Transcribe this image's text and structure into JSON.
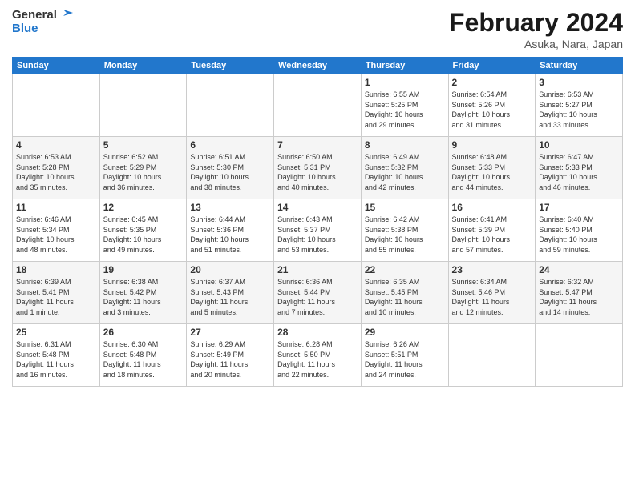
{
  "header": {
    "logo_general": "General",
    "logo_blue": "Blue",
    "month_title": "February 2024",
    "location": "Asuka, Nara, Japan"
  },
  "days_of_week": [
    "Sunday",
    "Monday",
    "Tuesday",
    "Wednesday",
    "Thursday",
    "Friday",
    "Saturday"
  ],
  "weeks": [
    [
      {
        "day": "",
        "detail": ""
      },
      {
        "day": "",
        "detail": ""
      },
      {
        "day": "",
        "detail": ""
      },
      {
        "day": "",
        "detail": ""
      },
      {
        "day": "1",
        "detail": "Sunrise: 6:55 AM\nSunset: 5:25 PM\nDaylight: 10 hours\nand 29 minutes."
      },
      {
        "day": "2",
        "detail": "Sunrise: 6:54 AM\nSunset: 5:26 PM\nDaylight: 10 hours\nand 31 minutes."
      },
      {
        "day": "3",
        "detail": "Sunrise: 6:53 AM\nSunset: 5:27 PM\nDaylight: 10 hours\nand 33 minutes."
      }
    ],
    [
      {
        "day": "4",
        "detail": "Sunrise: 6:53 AM\nSunset: 5:28 PM\nDaylight: 10 hours\nand 35 minutes."
      },
      {
        "day": "5",
        "detail": "Sunrise: 6:52 AM\nSunset: 5:29 PM\nDaylight: 10 hours\nand 36 minutes."
      },
      {
        "day": "6",
        "detail": "Sunrise: 6:51 AM\nSunset: 5:30 PM\nDaylight: 10 hours\nand 38 minutes."
      },
      {
        "day": "7",
        "detail": "Sunrise: 6:50 AM\nSunset: 5:31 PM\nDaylight: 10 hours\nand 40 minutes."
      },
      {
        "day": "8",
        "detail": "Sunrise: 6:49 AM\nSunset: 5:32 PM\nDaylight: 10 hours\nand 42 minutes."
      },
      {
        "day": "9",
        "detail": "Sunrise: 6:48 AM\nSunset: 5:33 PM\nDaylight: 10 hours\nand 44 minutes."
      },
      {
        "day": "10",
        "detail": "Sunrise: 6:47 AM\nSunset: 5:33 PM\nDaylight: 10 hours\nand 46 minutes."
      }
    ],
    [
      {
        "day": "11",
        "detail": "Sunrise: 6:46 AM\nSunset: 5:34 PM\nDaylight: 10 hours\nand 48 minutes."
      },
      {
        "day": "12",
        "detail": "Sunrise: 6:45 AM\nSunset: 5:35 PM\nDaylight: 10 hours\nand 49 minutes."
      },
      {
        "day": "13",
        "detail": "Sunrise: 6:44 AM\nSunset: 5:36 PM\nDaylight: 10 hours\nand 51 minutes."
      },
      {
        "day": "14",
        "detail": "Sunrise: 6:43 AM\nSunset: 5:37 PM\nDaylight: 10 hours\nand 53 minutes."
      },
      {
        "day": "15",
        "detail": "Sunrise: 6:42 AM\nSunset: 5:38 PM\nDaylight: 10 hours\nand 55 minutes."
      },
      {
        "day": "16",
        "detail": "Sunrise: 6:41 AM\nSunset: 5:39 PM\nDaylight: 10 hours\nand 57 minutes."
      },
      {
        "day": "17",
        "detail": "Sunrise: 6:40 AM\nSunset: 5:40 PM\nDaylight: 10 hours\nand 59 minutes."
      }
    ],
    [
      {
        "day": "18",
        "detail": "Sunrise: 6:39 AM\nSunset: 5:41 PM\nDaylight: 11 hours\nand 1 minute."
      },
      {
        "day": "19",
        "detail": "Sunrise: 6:38 AM\nSunset: 5:42 PM\nDaylight: 11 hours\nand 3 minutes."
      },
      {
        "day": "20",
        "detail": "Sunrise: 6:37 AM\nSunset: 5:43 PM\nDaylight: 11 hours\nand 5 minutes."
      },
      {
        "day": "21",
        "detail": "Sunrise: 6:36 AM\nSunset: 5:44 PM\nDaylight: 11 hours\nand 7 minutes."
      },
      {
        "day": "22",
        "detail": "Sunrise: 6:35 AM\nSunset: 5:45 PM\nDaylight: 11 hours\nand 10 minutes."
      },
      {
        "day": "23",
        "detail": "Sunrise: 6:34 AM\nSunset: 5:46 PM\nDaylight: 11 hours\nand 12 minutes."
      },
      {
        "day": "24",
        "detail": "Sunrise: 6:32 AM\nSunset: 5:47 PM\nDaylight: 11 hours\nand 14 minutes."
      }
    ],
    [
      {
        "day": "25",
        "detail": "Sunrise: 6:31 AM\nSunset: 5:48 PM\nDaylight: 11 hours\nand 16 minutes."
      },
      {
        "day": "26",
        "detail": "Sunrise: 6:30 AM\nSunset: 5:48 PM\nDaylight: 11 hours\nand 18 minutes."
      },
      {
        "day": "27",
        "detail": "Sunrise: 6:29 AM\nSunset: 5:49 PM\nDaylight: 11 hours\nand 20 minutes."
      },
      {
        "day": "28",
        "detail": "Sunrise: 6:28 AM\nSunset: 5:50 PM\nDaylight: 11 hours\nand 22 minutes."
      },
      {
        "day": "29",
        "detail": "Sunrise: 6:26 AM\nSunset: 5:51 PM\nDaylight: 11 hours\nand 24 minutes."
      },
      {
        "day": "",
        "detail": ""
      },
      {
        "day": "",
        "detail": ""
      }
    ]
  ]
}
